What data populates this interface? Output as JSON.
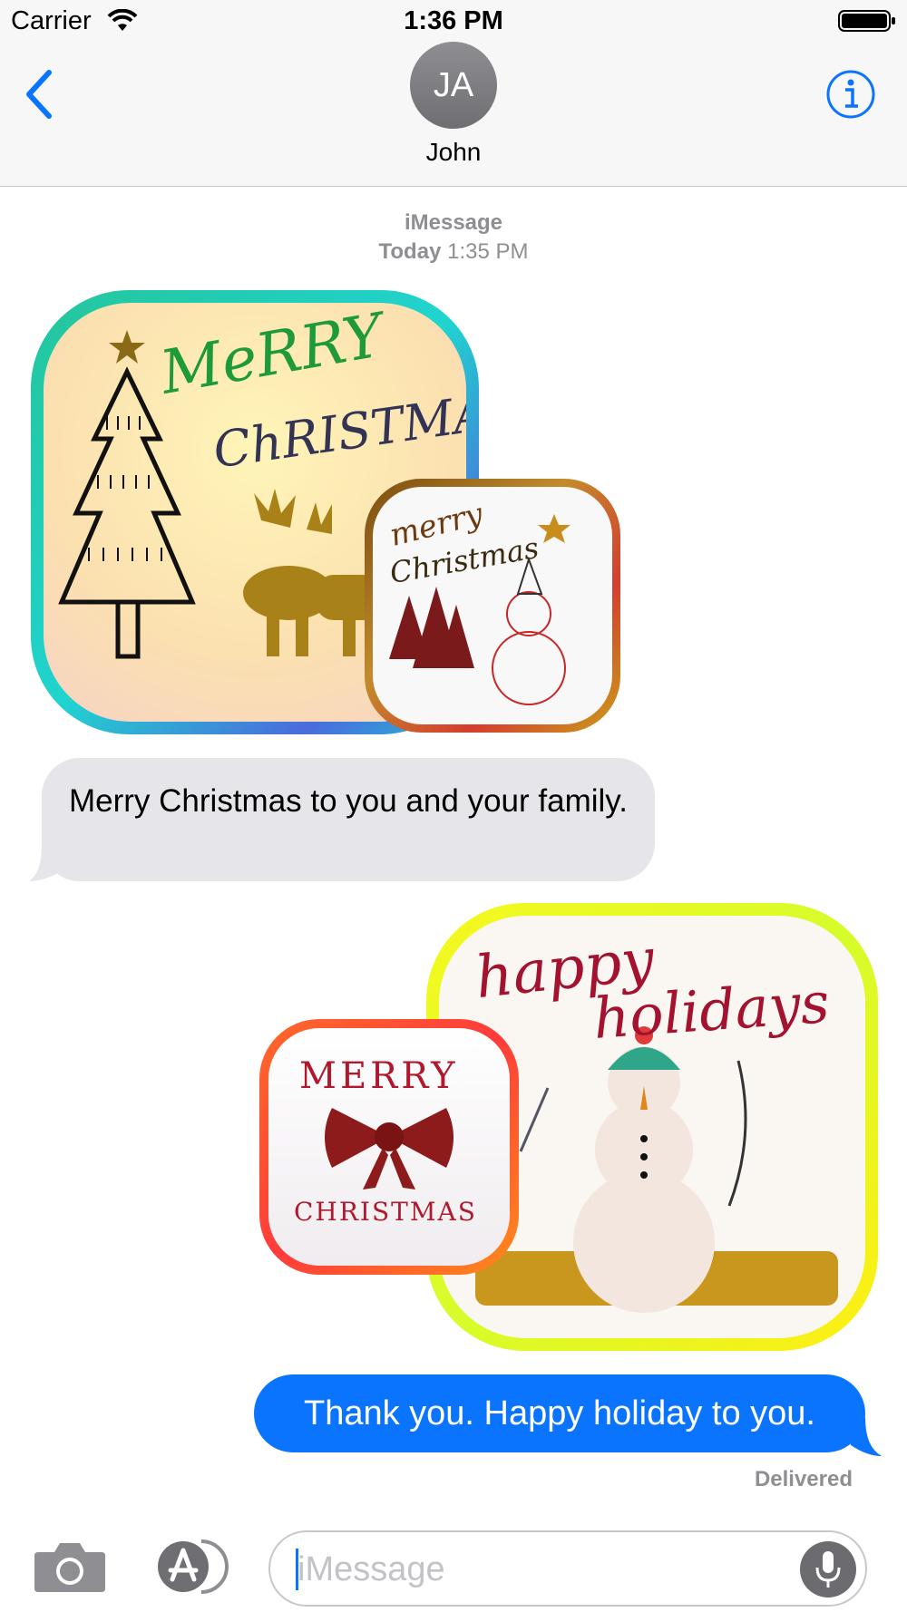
{
  "status_bar": {
    "carrier": "Carrier",
    "time": "1:36 PM"
  },
  "nav": {
    "avatar_initials": "JA",
    "contact_name": "John",
    "back_icon": "chevron-left-icon",
    "info_icon": "info-icon"
  },
  "thread": {
    "service": "iMessage",
    "day": "Today",
    "time": "1:35 PM"
  },
  "stickers": {
    "merry_christmas_large": {
      "line1": "MeRRY",
      "line2": "ChRISTMAS"
    },
    "merry_christmas_small": {
      "line1": "merry",
      "line2": "Christmas"
    },
    "happy_holidays": {
      "line1": "happy",
      "line2": "holidays"
    },
    "merry_christmas_bow": {
      "line1": "MERRY",
      "line2": "CHRISTMAS"
    }
  },
  "messages": [
    {
      "direction": "incoming",
      "text": "Merry Christmas to you and your family."
    },
    {
      "direction": "outgoing",
      "text": "Thank you. Happy holiday to you."
    }
  ],
  "delivery_status": "Delivered",
  "compose": {
    "placeholder": "iMessage"
  },
  "colors": {
    "accent": "#0a74ff",
    "incoming_bubble": "#e5e5ea",
    "outgoing_bubble": "#0a74ff"
  }
}
